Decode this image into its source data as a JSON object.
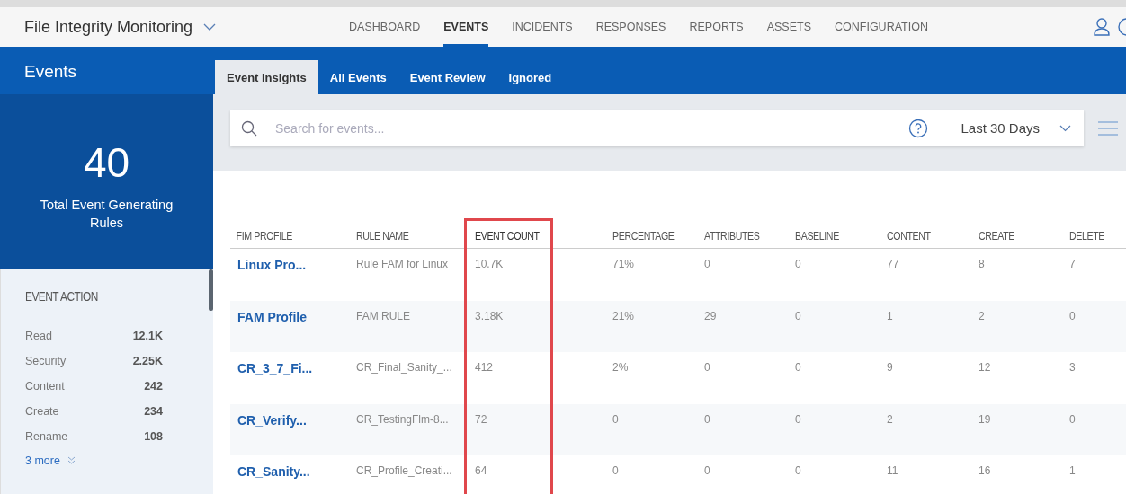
{
  "app": {
    "title": "File Integrity Monitoring"
  },
  "nav": [
    {
      "label": "DASHBOARD",
      "selected": false
    },
    {
      "label": "EVENTS",
      "selected": true
    },
    {
      "label": "INCIDENTS",
      "selected": false
    },
    {
      "label": "RESPONSES",
      "selected": false
    },
    {
      "label": "REPORTS",
      "selected": false
    },
    {
      "label": "ASSETS",
      "selected": false
    },
    {
      "label": "CONFIGURATION",
      "selected": false
    }
  ],
  "sidebar": {
    "title": "Events",
    "total": {
      "value": "40",
      "label": "Total Event Generating Rules"
    },
    "section": "EVENT ACTION",
    "items": [
      {
        "label": "Read",
        "count": "12.1K"
      },
      {
        "label": "Security",
        "count": "2.25K"
      },
      {
        "label": "Content",
        "count": "242"
      },
      {
        "label": "Create",
        "count": "234"
      },
      {
        "label": "Rename",
        "count": "108"
      }
    ],
    "more": "3 more"
  },
  "tabs": [
    {
      "label": "Event Insights",
      "selected": true
    },
    {
      "label": "All Events",
      "selected": false
    },
    {
      "label": "Event Review",
      "selected": false
    },
    {
      "label": "Ignored",
      "selected": false
    }
  ],
  "search": {
    "placeholder": "Search for events...",
    "range": "Last 30 Days"
  },
  "table": {
    "columns": [
      {
        "label": "FIM PROFILE",
        "highlighted": false
      },
      {
        "label": "RULE NAME",
        "highlighted": false
      },
      {
        "label": "EVENT COUNT",
        "highlighted": true
      },
      {
        "label": "PERCENTAGE",
        "highlighted": false
      },
      {
        "label": "ATTRIBUTES",
        "highlighted": false
      },
      {
        "label": "BASELINE",
        "highlighted": false
      },
      {
        "label": "CONTENT",
        "highlighted": false
      },
      {
        "label": "CREATE",
        "highlighted": false
      },
      {
        "label": "DELETE",
        "highlighted": false
      }
    ],
    "rows": [
      [
        "Linux Pro...",
        "Rule FAM for Linux",
        "10.7K",
        "71%",
        "0",
        "0",
        "77",
        "8",
        "7"
      ],
      [
        "FAM Profile",
        "FAM RULE",
        "3.18K",
        "21%",
        "29",
        "0",
        "1",
        "2",
        "0"
      ],
      [
        "CR_3_7_Fi...",
        "CR_Final_Sanity_...",
        "412",
        "2%",
        "0",
        "0",
        "9",
        "12",
        "3"
      ],
      [
        "CR_Verify...",
        "CR_TestingFlm-8...",
        "72",
        "0",
        "0",
        "0",
        "2",
        "19",
        "0"
      ],
      [
        "CR_Sanity...",
        "CR_Profile_Creati...",
        "64",
        "0",
        "0",
        "0",
        "11",
        "16",
        "1"
      ]
    ]
  }
}
